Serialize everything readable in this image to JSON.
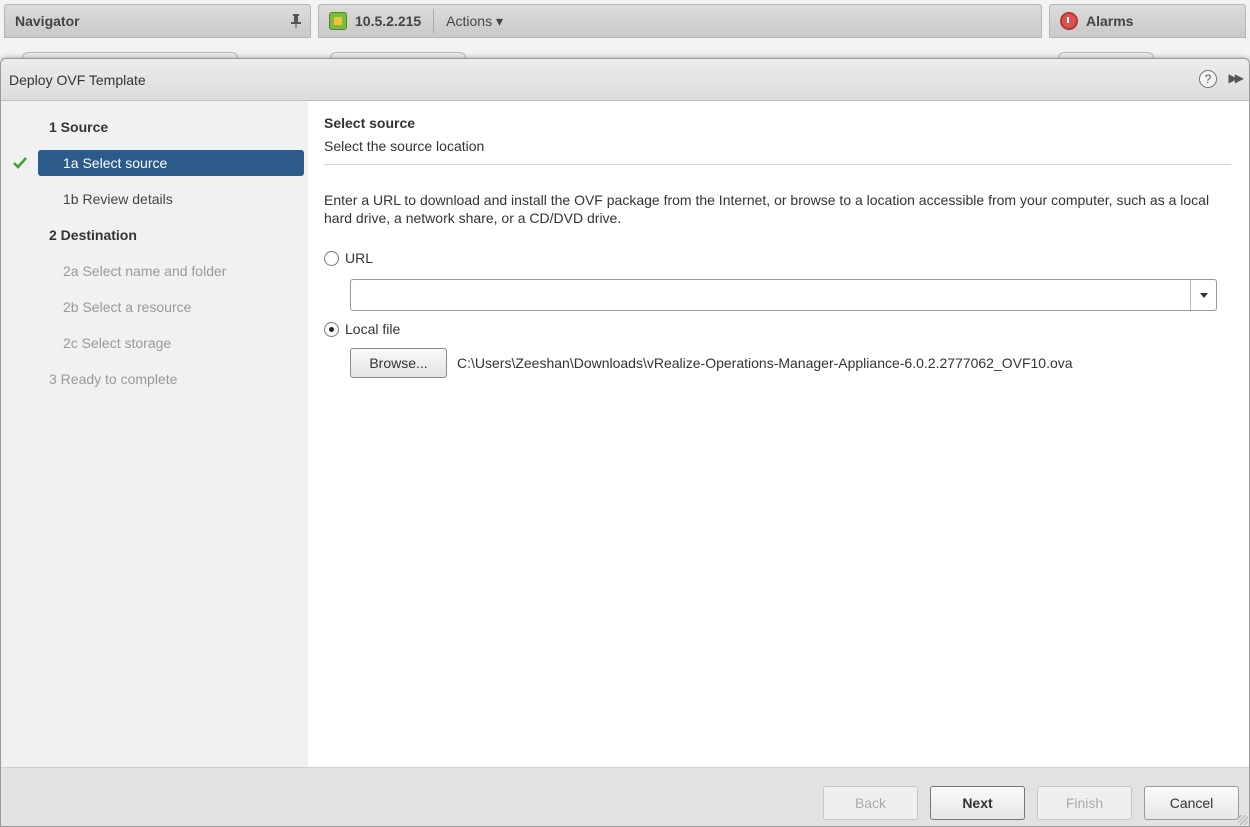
{
  "app": {
    "navigator_title": "Navigator",
    "host_title": "10.5.2.215",
    "actions_label": "Actions",
    "alarms_title": "Alarms"
  },
  "dialog": {
    "title": "Deploy OVF Template",
    "help_label": "?"
  },
  "steps": [
    {
      "label": "1  Source",
      "state": "major"
    },
    {
      "label": "1a  Select source",
      "state": "active"
    },
    {
      "label": "1b  Review details",
      "state": "minor"
    },
    {
      "label": "2  Destination",
      "state": "major"
    },
    {
      "label": "2a  Select name and folder",
      "state": "disabled"
    },
    {
      "label": "2b  Select a resource",
      "state": "disabled"
    },
    {
      "label": "2c  Select storage",
      "state": "disabled"
    },
    {
      "label": "3  Ready to complete",
      "state": "disabled"
    }
  ],
  "content": {
    "section_title": "Select source",
    "section_subtitle": "Select the source location",
    "description": "Enter a URL to download and install the OVF package from the Internet, or browse to a location accessible from your computer, such as a local hard drive, a network share, or a CD/DVD drive.",
    "url_option_label": "URL",
    "url_value": "",
    "local_file_option_label": "Local file",
    "selected_option": "local_file",
    "browse_label": "Browse...",
    "file_path": "C:\\Users\\Zeeshan\\Downloads\\vRealize-Operations-Manager-Appliance-6.0.2.2777062_OVF10.ova"
  },
  "footer": {
    "back_label": "Back",
    "next_label": "Next",
    "finish_label": "Finish",
    "cancel_label": "Cancel"
  },
  "colors": {
    "active_step_bg": "#2c5a8a",
    "check_green": "#3aa335"
  }
}
